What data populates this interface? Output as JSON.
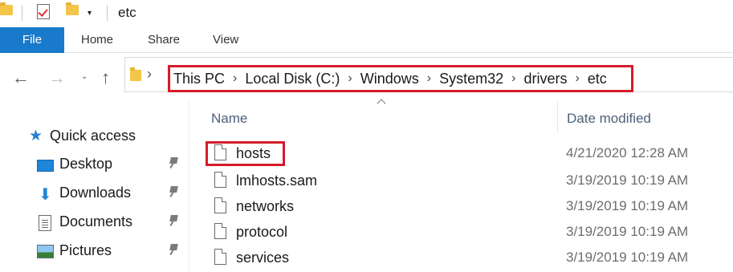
{
  "window": {
    "title": "etc"
  },
  "quick_access_toolbar": {
    "dropdown_glyph": "▾"
  },
  "ribbon": {
    "tabs": [
      {
        "label": "File",
        "active": true
      },
      {
        "label": "Home"
      },
      {
        "label": "Share"
      },
      {
        "label": "View"
      }
    ]
  },
  "navigation": {
    "back_glyph": "←",
    "forward_glyph": "→",
    "recent_glyph": "⌄",
    "up_glyph": "↑",
    "address_arrow_glyph": "›",
    "breadcrumb": [
      "This PC",
      "Local Disk (C:)",
      "Windows",
      "System32",
      "drivers",
      "etc"
    ],
    "separator_glyph": "›"
  },
  "sidebar": {
    "quick_access_label": "Quick access",
    "items": [
      {
        "label": "Desktop",
        "icon": "desktop-icon",
        "pinned": true
      },
      {
        "label": "Downloads",
        "icon": "download-icon",
        "pinned": true
      },
      {
        "label": "Documents",
        "icon": "documents-icon",
        "pinned": true
      },
      {
        "label": "Pictures",
        "icon": "pictures-icon",
        "pinned": true
      }
    ]
  },
  "file_list": {
    "columns": {
      "name": "Name",
      "date_modified": "Date modified"
    },
    "rows": [
      {
        "name": "hosts",
        "date": "4/21/2020 12:28 AM",
        "highlighted": true
      },
      {
        "name": "lmhosts.sam",
        "date": "3/19/2019 10:19 AM"
      },
      {
        "name": "networks",
        "date": "3/19/2019 10:19 AM"
      },
      {
        "name": "protocol",
        "date": "3/19/2019 10:19 AM"
      },
      {
        "name": "services",
        "date": "3/19/2019 10:19 AM"
      }
    ]
  },
  "colors": {
    "accent": "#1979ca",
    "highlight": "#d41c2a",
    "folder": "#f3c649"
  }
}
